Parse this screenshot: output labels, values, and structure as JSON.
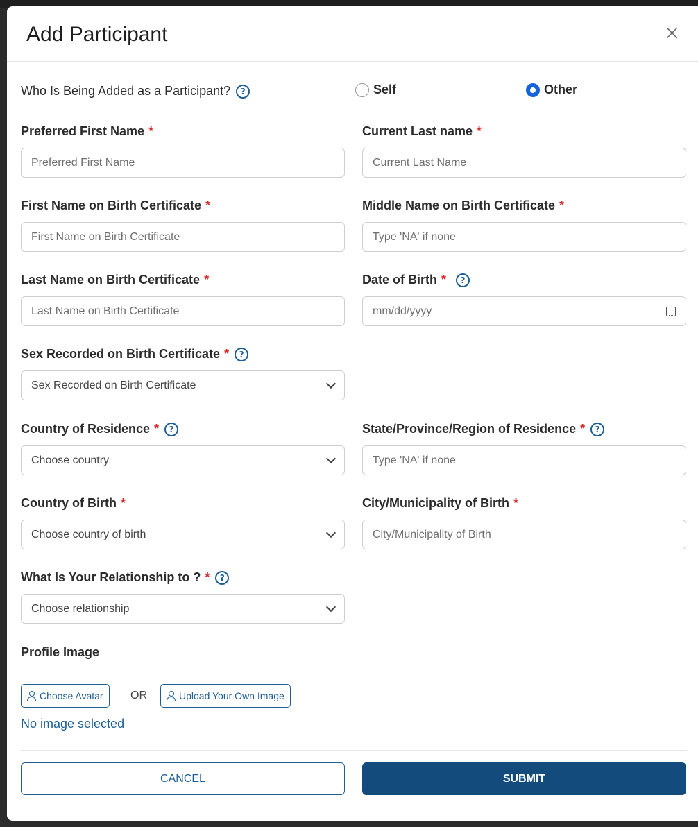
{
  "modal": {
    "title": "Add Participant",
    "close_label": "×"
  },
  "participant_type": {
    "question": "Who Is Being Added as a Participant?",
    "options": [
      "Self",
      "Other"
    ],
    "selected": "Other"
  },
  "help_glyph": "?",
  "required_marker": "*",
  "fields": {
    "preferred_first_name": {
      "label": "Preferred First Name",
      "placeholder": "Preferred First Name",
      "value": ""
    },
    "current_last_name": {
      "label": "Current Last name",
      "placeholder": "Current Last Name",
      "value": ""
    },
    "first_name_birth": {
      "label": "First Name on Birth Certificate",
      "placeholder": "First Name on Birth Certificate",
      "value": ""
    },
    "middle_name_birth": {
      "label": "Middle Name on Birth Certificate",
      "placeholder": "Type 'NA' if none",
      "value": ""
    },
    "last_name_birth": {
      "label": "Last Name on Birth Certificate",
      "placeholder": "Last Name on Birth Certificate",
      "value": ""
    },
    "date_of_birth": {
      "label": "Date of Birth",
      "placeholder": "mm/dd/yyyy",
      "value": ""
    },
    "sex": {
      "label": "Sex Recorded on Birth Certificate",
      "selected": "Sex Recorded on Birth Certificate"
    },
    "country_residence": {
      "label": "Country of Residence",
      "selected": "Choose country"
    },
    "state_residence": {
      "label": "State/Province/Region of Residence",
      "placeholder": "Type 'NA' if none",
      "value": ""
    },
    "country_birth": {
      "label": "Country of Birth",
      "selected": "Choose country of birth"
    },
    "city_birth": {
      "label": "City/Municipality of Birth",
      "placeholder": "City/Municipality of Birth",
      "value": ""
    },
    "relationship": {
      "label": "What Is Your Relationship to ?",
      "selected": "Choose relationship"
    }
  },
  "profile_image": {
    "label": "Profile Image",
    "choose_avatar": "Choose Avatar",
    "or_text": "OR",
    "upload_own": "Upload Your Own Image",
    "status": "No image selected"
  },
  "actions": {
    "cancel": "CANCEL",
    "submit": "SUBMIT"
  },
  "colors": {
    "primary": "#124b7c",
    "link": "#1d5e94",
    "radio_checked": "#1565d8",
    "required": "#d62828"
  }
}
